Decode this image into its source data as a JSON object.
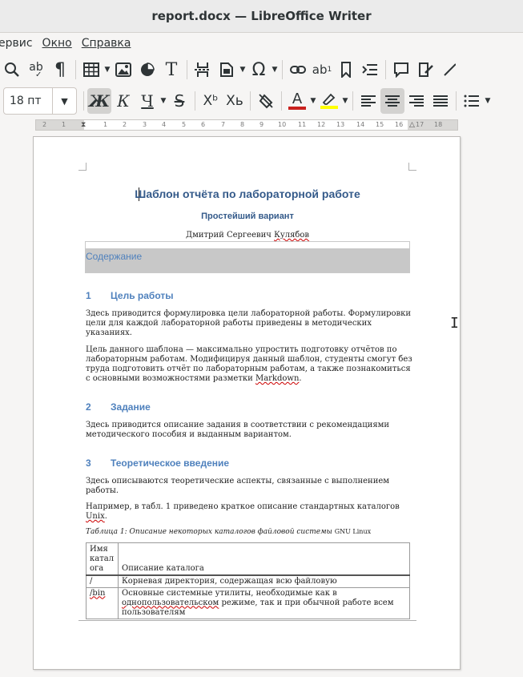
{
  "window": {
    "title": "report.docx — LibreOffice Writer"
  },
  "menu": [
    {
      "label": "ервис"
    },
    {
      "label": "Окно"
    },
    {
      "label": "Справка"
    }
  ],
  "toolbar1": {
    "icons": [
      "find-icon",
      "spellcheck-icon",
      "formatting-marks-icon",
      "insert-table-icon",
      "insert-image-icon",
      "insert-chart-icon",
      "insert-textbox-icon",
      "page-break-icon",
      "insert-field-icon",
      "special-character-icon",
      "hyperlink-icon",
      "footnote-icon",
      "bookmark-icon",
      "cross-reference-icon",
      "comment-icon",
      "track-changes-icon",
      "draw-line-icon"
    ]
  },
  "toolbar2": {
    "font_size": "18 пт",
    "bold": "Ж",
    "italic": "К",
    "underline": "Ч",
    "strike": "S",
    "superscript": "Xᵇ",
    "subscript": "Xь",
    "font_color": "#c9211e",
    "highlight_color": "#ffff00"
  },
  "ruler": {
    "ticks": [
      "2",
      "1",
      "1",
      "2",
      "3",
      "4",
      "5",
      "6",
      "7",
      "8",
      "9",
      "10",
      "11",
      "12",
      "13",
      "14",
      "15",
      "16",
      "17",
      "18"
    ]
  },
  "document": {
    "title": "Шаблон отчёта по лабораторной работе",
    "subtitle": "Простейший вариант",
    "author_first": "Дмитрий Сергеевич ",
    "author_last": "Кулябов",
    "toc_heading": "Содержание",
    "sections": [
      {
        "num": "1",
        "title": "Цель работы"
      },
      {
        "num": "2",
        "title": "Задание"
      },
      {
        "num": "3",
        "title": "Теоретическое введение"
      }
    ],
    "p1": "Здесь приводится формулировка цели лабораторной работы. Формулировки цели для каждой лабораторной работы приведены в методических указаниях.",
    "p2_a": "Цель данного шаблона — максимально упростить подготовку отчётов по лабораторным работам. Модифицируя данный шаблон, студенты смогут без труда подготовить отчёт по лабораторным работам, а также познакомиться с основными возможностями разметки ",
    "p2_b": "Markdown",
    "p2_c": ".",
    "p3": "Здесь приводится описание задания в соответствии с рекомендациями методического пособия и выданным вариантом.",
    "p4": "Здесь описываются теоретические аспекты, связанные с выполнением работы.",
    "p5_a": "Например, в табл. 1 приведено краткое описание стандартных каталогов ",
    "p5_b": "Unix",
    "p5_c": ".",
    "caption_a": "Таблица 1: Описание некоторых каталогов файловой системы ",
    "caption_b": "GNU Linux",
    "table": {
      "headers": [
        "Имя катал ога",
        "Описание каталога"
      ],
      "rows": [
        {
          "name": "/",
          "desc_a": "Корневая директория, содержащая всю файловую",
          "desc_b": "",
          "desc_c": ""
        },
        {
          "name": "/bin",
          "desc_a": "Основные системные утилиты, необходимые как в ",
          "desc_b": "однопользовательском",
          "desc_c": " режиме, так и при обычной работе всем пользователям"
        }
      ]
    }
  }
}
